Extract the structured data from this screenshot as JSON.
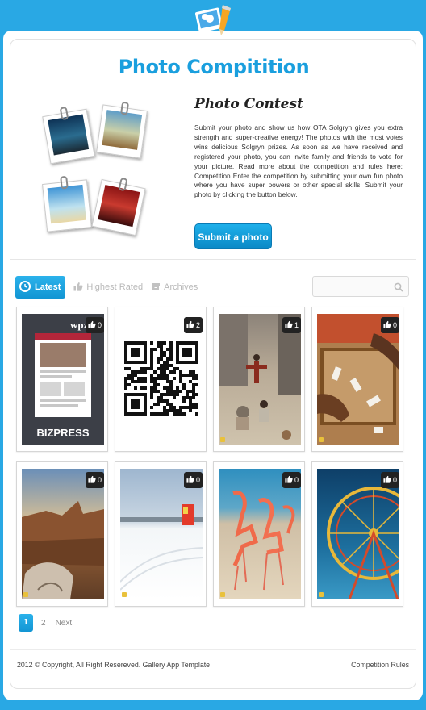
{
  "app": {
    "logo_icon": "photo-pencil-logo-icon"
  },
  "header": {
    "title": "Photo Compitition"
  },
  "contest": {
    "title": "Photo Contest",
    "description": "Submit your photo and show us how OTA Solgryn gives you extra strength and super-creative energy! The photos with the most votes wins delicious Solgryn prizes. As soon as we have received and registered your photo, you can invite family and friends to vote for your picture. Read more about the competition and rules here: Competition Enter the competition by submitting your own fun photo where you have super powers or other special skills. Submit your photo by clicking the button below.",
    "submit_label": "Submit a photo"
  },
  "tabs": [
    {
      "label": "Latest",
      "icon": "clock-icon",
      "active": true
    },
    {
      "label": "Highest Rated",
      "icon": "thumbs-up-icon",
      "active": false
    },
    {
      "label": "Archives",
      "icon": "archive-icon",
      "active": false
    }
  ],
  "search": {
    "placeholder": "",
    "icon": "search-icon"
  },
  "gallery": [
    {
      "name": "bizpress-theme-photo",
      "votes": "0"
    },
    {
      "name": "qr-code-photo",
      "votes": "2"
    },
    {
      "name": "children-street-photo",
      "votes": "1"
    },
    {
      "name": "dominoes-game-photo",
      "votes": "0"
    },
    {
      "name": "canyon-landscape-photo",
      "votes": "0"
    },
    {
      "name": "snow-field-photo",
      "votes": "0"
    },
    {
      "name": "flamingos-photo",
      "votes": "0"
    },
    {
      "name": "ferris-wheel-photo",
      "votes": "0"
    }
  ],
  "pagination": {
    "current": "1",
    "next_page": "2",
    "next_label": "Next"
  },
  "footer": {
    "copyright": "2012 © Copyright, All Right Resereved. Gallery App Template",
    "rules_link": "Competition Rules"
  },
  "colors": {
    "background": "#29a8e4",
    "accent": "#1a9fde",
    "button": "#0b89c6"
  }
}
